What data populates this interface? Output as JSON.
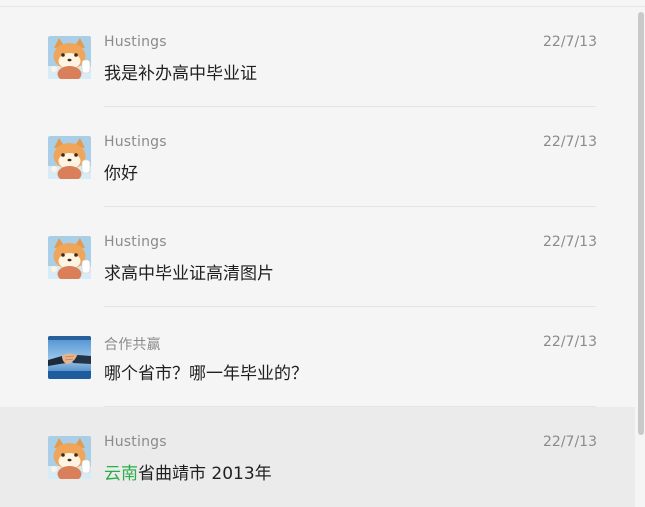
{
  "messages": [
    {
      "sender": "Hustings",
      "date": "22/7/13",
      "text": "我是补办高中毕业证",
      "avatar": "shiba-dog-avatar"
    },
    {
      "sender": "Hustings",
      "date": "22/7/13",
      "text": "你好",
      "avatar": "shiba-dog-avatar"
    },
    {
      "sender": "Hustings",
      "date": "22/7/13",
      "text": "求高中毕业证高清图片",
      "avatar": "shiba-dog-avatar"
    },
    {
      "sender": "合作共赢",
      "date": "22/7/13",
      "text": "哪个省市？哪一年毕业的？",
      "avatar": "handshake-avatar"
    },
    {
      "sender": "Hustings",
      "date": "22/7/13",
      "text_highlight": "云南",
      "text_rest": "省曲靖市 2013年",
      "avatar": "shiba-dog-avatar",
      "highlight_color": "#2aae47"
    }
  ],
  "colors": {
    "background": "#f5f5f5",
    "selected_row": "#ebebeb",
    "name_text": "#8b8b8b",
    "message_text": "#1f1f1f"
  }
}
